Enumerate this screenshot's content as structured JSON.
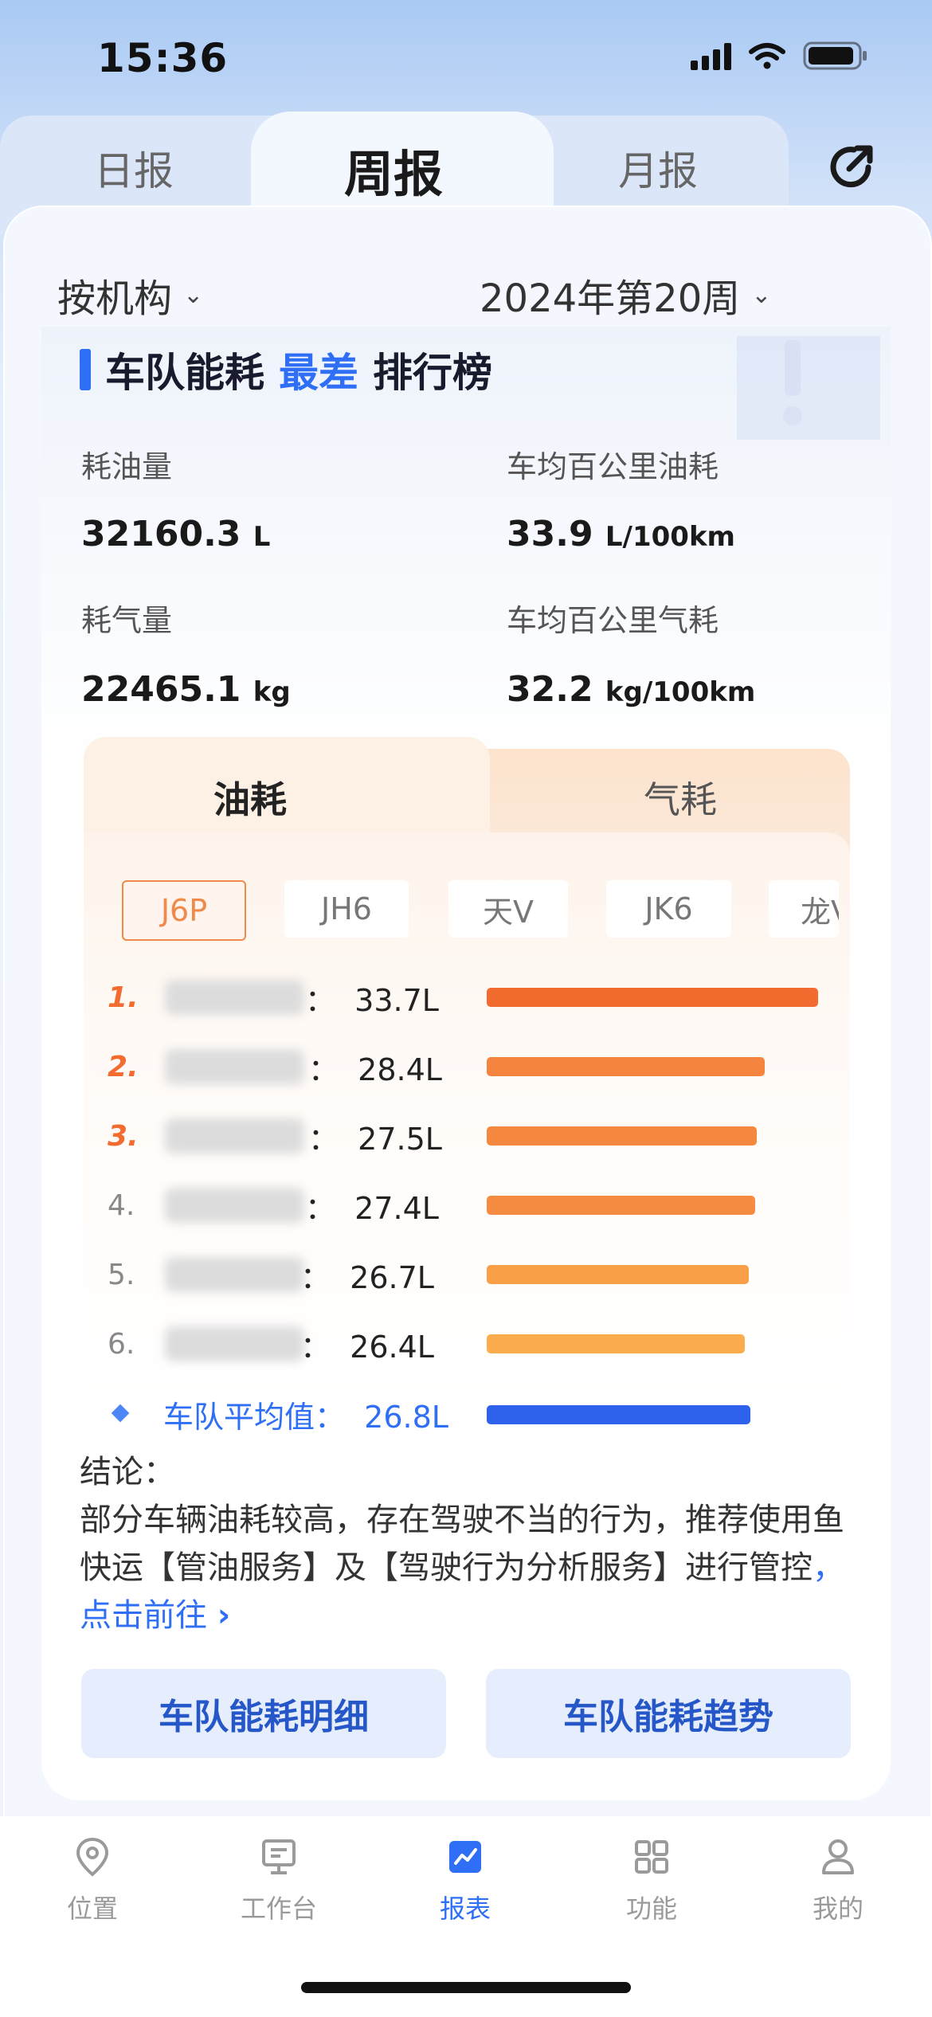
{
  "status_bar": {
    "time": "15:36"
  },
  "tabs": [
    {
      "label": "日报",
      "active": false
    },
    {
      "label": "周报",
      "active": true
    },
    {
      "label": "月报",
      "active": false
    }
  ],
  "filters": {
    "org": "按机构",
    "period": "2024年第20周"
  },
  "section": {
    "title_pre": "车队能耗",
    "title_highlight": "最差",
    "title_post": "排行榜"
  },
  "stats": [
    {
      "label": "耗油量",
      "value": "32160.3",
      "unit": "L"
    },
    {
      "label": "车均百公里油耗",
      "value": "33.9",
      "unit": "L/100km"
    },
    {
      "label": "耗气量",
      "value": "22465.1",
      "unit": "kg"
    },
    {
      "label": "车均百公里气耗",
      "value": "32.2",
      "unit": "kg/100km"
    }
  ],
  "fuel_tabs": {
    "oil": "油耗",
    "gas": "气耗"
  },
  "models": [
    {
      "label": "J6P",
      "active": true
    },
    {
      "label": "JH6",
      "active": false
    },
    {
      "label": "天V",
      "active": false
    },
    {
      "label": "JK6",
      "active": false
    },
    {
      "label": "龙V",
      "active": false
    }
  ],
  "ranking": [
    {
      "rank": "1.",
      "value": "：  33.7L",
      "fraction": 1.0,
      "color": "#f26b2f"
    },
    {
      "rank": "2.",
      "value": "：  28.4L",
      "fraction": 0.84,
      "color": "#f5843e"
    },
    {
      "rank": "3.",
      "value": "：  27.5L",
      "fraction": 0.815,
      "color": "#f5883f"
    },
    {
      "rank": "4.",
      "value": "：  27.4L",
      "fraction": 0.81,
      "color": "#f68c42"
    },
    {
      "rank": "5.",
      "value": "：  26.7L",
      "fraction": 0.79,
      "color": "#f99f47"
    },
    {
      "rank": "6.",
      "value": "：  26.4L",
      "fraction": 0.78,
      "color": "#fbad4d"
    }
  ],
  "average": {
    "label": "车队平均值：  26.8L",
    "fraction": 0.795,
    "color": "#2f62ec"
  },
  "conclusion": {
    "heading": "结论：",
    "body": "部分车辆油耗较高，存在驾驶不当的行为，推荐使用鱼快运【管油服务】及【驾驶行为分析服务】进行管控",
    "link": "，点击前往",
    "link_arrow": "›"
  },
  "buttons": {
    "detail": "车队能耗明细",
    "trend": "车队能耗趋势"
  },
  "nav": [
    {
      "label": "位置",
      "icon": "location-pin-icon",
      "active": false
    },
    {
      "label": "工作台",
      "icon": "monitor-icon",
      "active": false
    },
    {
      "label": "报表",
      "icon": "chart-report-icon",
      "active": true
    },
    {
      "label": "功能",
      "icon": "grid-apps-icon",
      "active": false
    },
    {
      "label": "我的",
      "icon": "user-icon",
      "active": false
    }
  ]
}
